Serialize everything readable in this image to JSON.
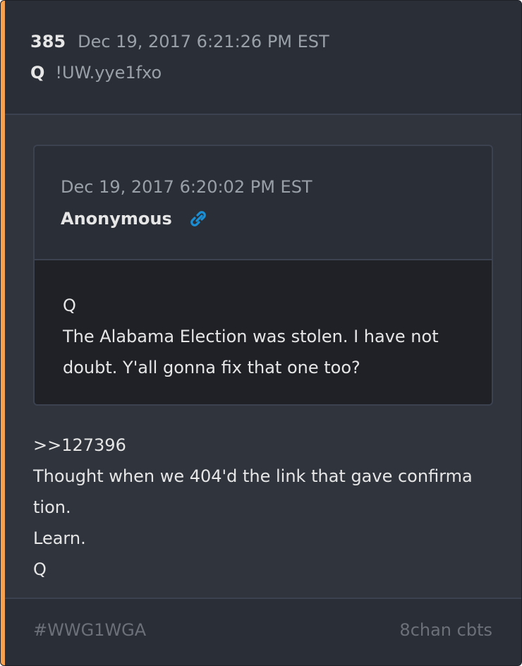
{
  "post": {
    "number": "385",
    "timestamp": "Dec 19, 2017 6:21:26 PM EST",
    "author": "Q",
    "tripcode": "!UW.yye1fxo"
  },
  "quoted_post": {
    "timestamp": "Dec 19, 2017 6:20:02 PM EST",
    "author": "Anonymous",
    "link_icon": "link-icon",
    "body_lines": [
      "Q",
      "The Alabama Election was stolen.  I have not",
      "doubt.  Y'all gonna fix that one too?"
    ]
  },
  "body_lines": [
    ">>127396",
    "Thought when we 404'd the link that gave confirma",
    "tion.",
    "Learn.",
    "Q"
  ],
  "footer": {
    "hashtag": "#WWG1WGA",
    "source": "8chan cbts"
  },
  "colors": {
    "accent": "#f6a150",
    "link_icon": "#1a8fd6",
    "card_bg": "#2f343d",
    "quote_body_bg": "#1f2127"
  }
}
